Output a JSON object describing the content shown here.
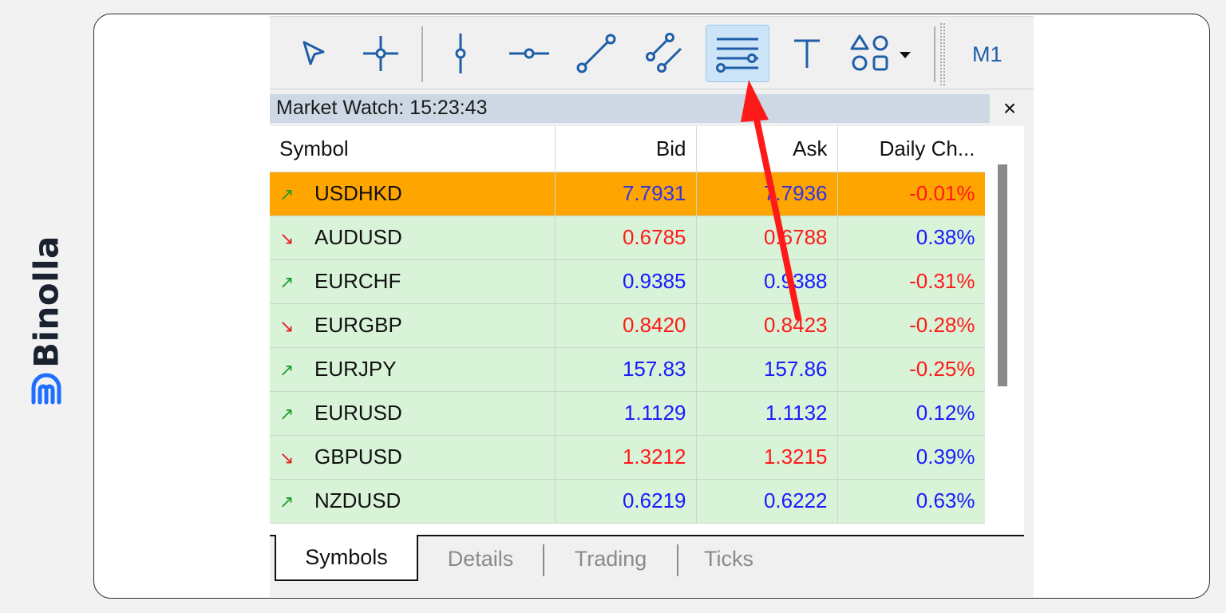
{
  "brand": {
    "name": "Binolla",
    "logo_icon": "binolla-logo-icon"
  },
  "toolbar": {
    "tools": [
      {
        "name": "cursor-icon"
      },
      {
        "name": "crosshair-icon"
      },
      {
        "name": "vertical-line-icon"
      },
      {
        "name": "horizontal-line-icon"
      },
      {
        "name": "trendline-icon"
      },
      {
        "name": "equidistant-channel-icon"
      },
      {
        "name": "fibonacci-retracement-icon",
        "active": true
      },
      {
        "name": "text-icon"
      },
      {
        "name": "shapes-icon"
      }
    ],
    "timeframe": "M1",
    "active_color": "#cce4f7",
    "icon_color": "#1f5ea8"
  },
  "market_watch": {
    "title": "Market Watch: 15:23:43",
    "close_label": "×",
    "columns": [
      "Symbol",
      "Bid",
      "Ask",
      "Daily Ch..."
    ],
    "rows": [
      {
        "dir": "up",
        "arrow": "↗",
        "symbol": "USDHKD",
        "bid": "7.7931",
        "ask": "7.7936",
        "change": "-0.01%",
        "highlight": true,
        "price_color": "#3434e0",
        "change_color": "#ff1a1a"
      },
      {
        "dir": "down",
        "arrow": "↘",
        "symbol": "AUDUSD",
        "bid": "0.6785",
        "ask": "0.6788",
        "change": "0.38%",
        "price_color": "#ff1a1a",
        "change_color": "#1a1aff"
      },
      {
        "dir": "up",
        "arrow": "↗",
        "symbol": "EURCHF",
        "bid": "0.9385",
        "ask": "0.9388",
        "change": "-0.31%",
        "price_color": "#1a1aff",
        "change_color": "#ff1a1a"
      },
      {
        "dir": "down",
        "arrow": "↘",
        "symbol": "EURGBP",
        "bid": "0.8420",
        "ask": "0.8423",
        "change": "-0.28%",
        "price_color": "#ff1a1a",
        "change_color": "#ff1a1a"
      },
      {
        "dir": "up",
        "arrow": "↗",
        "symbol": "EURJPY",
        "bid": "157.83",
        "ask": "157.86",
        "change": "-0.25%",
        "price_color": "#1a1aff",
        "change_color": "#ff1a1a"
      },
      {
        "dir": "up",
        "arrow": "↗",
        "symbol": "EURUSD",
        "bid": "1.1129",
        "ask": "1.1132",
        "change": "0.12%",
        "price_color": "#1a1aff",
        "change_color": "#1a1aff"
      },
      {
        "dir": "down",
        "arrow": "↘",
        "symbol": "GBPUSD",
        "bid": "1.3212",
        "ask": "1.3215",
        "change": "0.39%",
        "price_color": "#ff1a1a",
        "change_color": "#1a1aff"
      },
      {
        "dir": "up",
        "arrow": "↗",
        "symbol": "NZDUSD",
        "bid": "0.6219",
        "ask": "0.6222",
        "change": "0.63%",
        "price_color": "#1a1aff",
        "change_color": "#1a1aff"
      }
    ],
    "row_bg": "#d8f3d8",
    "highlight_bg": "#ffa500",
    "tabs": [
      {
        "label": "Symbols",
        "active": true
      },
      {
        "label": "Details"
      },
      {
        "label": "Trading"
      },
      {
        "label": "Ticks"
      }
    ]
  },
  "annotation": {
    "color": "#ff1a1a",
    "target": "fibonacci-retracement-icon"
  }
}
